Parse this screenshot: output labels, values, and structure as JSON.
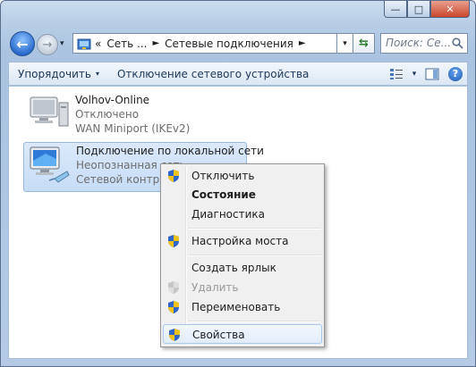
{
  "window": {
    "caption_min": "—",
    "caption_max": "□",
    "caption_close": "✕"
  },
  "nav": {
    "back_glyph": "←",
    "forward_glyph": "→",
    "dropdown_glyph": "▾",
    "address": {
      "prefix": "«",
      "segments": [
        "Сеть ...",
        "Сетевые подключения"
      ],
      "separator": "►",
      "dropdown_glyph": "▾"
    },
    "refresh_glyph": "⇆",
    "search_placeholder": "Поиск: Се..."
  },
  "commandbar": {
    "organize_label": "Упорядочить",
    "disable_device_label": "Отключение сетевого устройства",
    "dropdown_glyph": "▾",
    "help_glyph": "?"
  },
  "connections": [
    {
      "name": "Volhov-Online",
      "status": "Отключено",
      "device": "WAN Miniport (IKEv2)"
    },
    {
      "name": "Подключение по локальной сети",
      "status": "Неопознанная сеть",
      "device": "Сетевой контроллер"
    }
  ],
  "context_menu": {
    "items": [
      {
        "label": "Отключить",
        "icon": "shield-icon",
        "style": "normal"
      },
      {
        "label": "Состояние",
        "icon": "",
        "style": "bold"
      },
      {
        "label": "Диагностика",
        "icon": "",
        "style": "normal"
      },
      {
        "label": "Настройка моста",
        "icon": "shield-icon",
        "style": "normal"
      },
      {
        "label": "Создать ярлык",
        "icon": "",
        "style": "normal"
      },
      {
        "label": "Удалить",
        "icon": "shield-icon",
        "style": "disabled"
      },
      {
        "label": "Переименовать",
        "icon": "shield-icon",
        "style": "normal"
      },
      {
        "label": "Свойства",
        "icon": "shield-icon",
        "style": "hover"
      }
    ]
  },
  "colors": {
    "frame": "#b7cde6",
    "selection": "#c6dcf6",
    "menu_bg": "#f0f0f0"
  }
}
